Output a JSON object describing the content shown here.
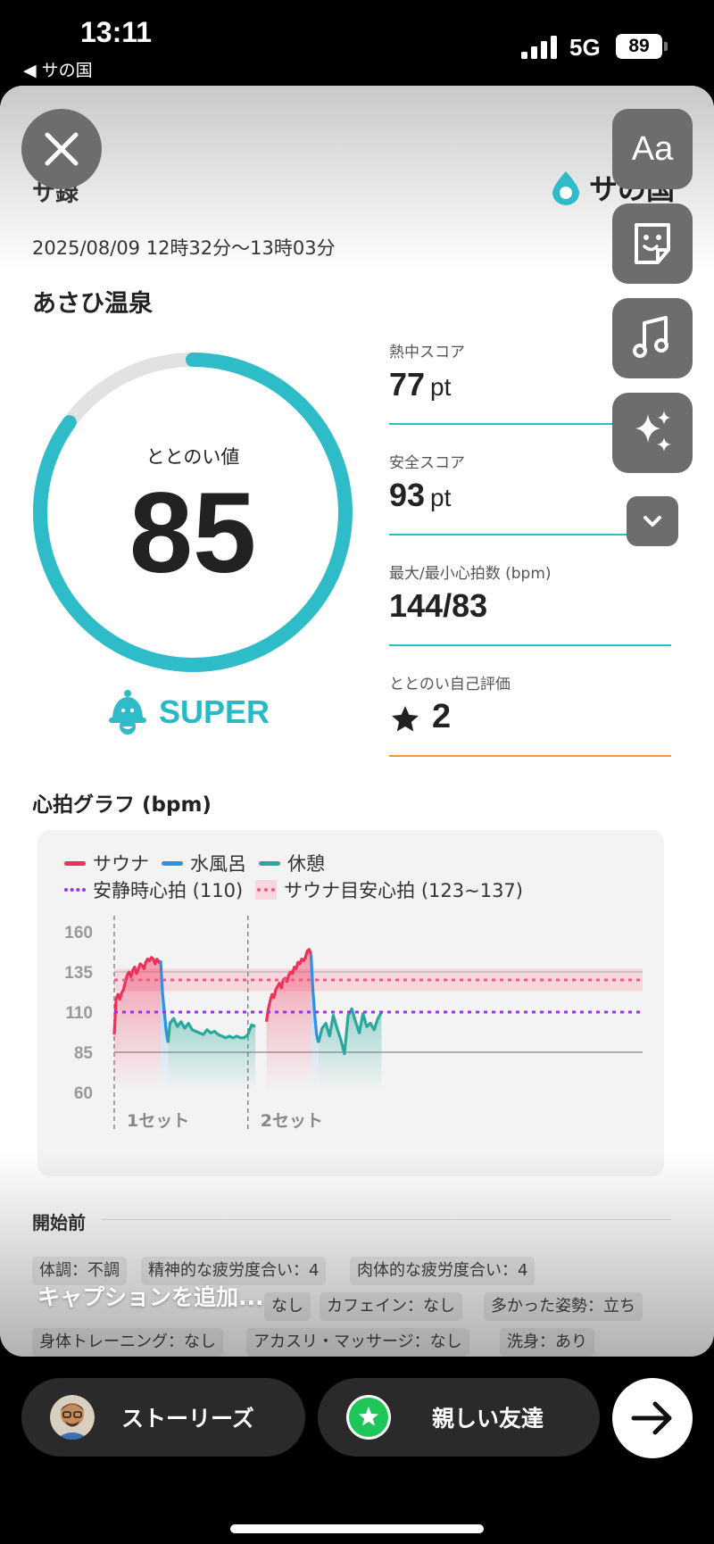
{
  "status_bar": {
    "time": "13:11",
    "back_app": "◀ サの国",
    "network": "5G",
    "battery": "89"
  },
  "card": {
    "title_fragment": "サ録",
    "brand_name": "サの国",
    "date_range": "2025/08/09 12時32分〜13時03分",
    "place": "あさひ温泉",
    "gauge": {
      "label": "ととのい値",
      "value": "85",
      "value_max": 100,
      "grade": "SUPER",
      "accent_color": "#2fbcc9"
    },
    "stats": [
      {
        "label": "熱中スコア",
        "value": "77",
        "unit": "pt"
      },
      {
        "label": "安全スコア",
        "value": "93",
        "unit": "pt"
      },
      {
        "label": "最大/最小心拍数 (bpm)",
        "value": "144/83",
        "unit": ""
      },
      {
        "label": "ととのい自己評価",
        "value": "2",
        "unit": ""
      }
    ],
    "heart_chart": {
      "title": "心拍グラフ (bpm)",
      "legend": {
        "sauna": "サウナ",
        "cold_bath": "水風呂",
        "rest": "休憩",
        "resting_hr": "安静時心拍 (110)",
        "sauna_target": "サウナ目安心拍 (123~137)"
      },
      "set_labels": [
        "1セット",
        "2セット"
      ]
    },
    "before": {
      "title": "開始前",
      "chips": [
        "体調：不調",
        "精神的な疲労度合い：4",
        "肉体的な疲労度合い：4",
        "なし",
        "カフェイン：なし",
        "多かった姿勢：立ち",
        "身体トレーニング：なし",
        "アカスリ・マッサージ：なし",
        "洗身：あり"
      ]
    },
    "caption_placeholder": "キャプションを追加..."
  },
  "toolbar": {
    "text_tool": "Aa"
  },
  "share_bar": {
    "stories": "ストーリーズ",
    "close_friends": "親しい友達"
  },
  "colors": {
    "sauna": "#f0305a",
    "cold_bath": "#2d8fe6",
    "rest": "#2aa89b",
    "resting_hr": "#9b30e6",
    "sauna_target": "#ef5a8a",
    "teal": "#2fbcc9",
    "orange": "#f2973a"
  },
  "chart_data": {
    "type": "line",
    "title": "心拍グラフ (bpm)",
    "xlabel": "",
    "ylabel": "",
    "ylim": [
      60,
      160
    ],
    "yticks": [
      160,
      135,
      110,
      85,
      60
    ],
    "x_categories": [
      "1セット",
      "2セット"
    ],
    "reference_lines": [
      {
        "name": "安静時心拍 (110)",
        "value": 110
      },
      {
        "name": "サウナ目安心拍 (123~137)",
        "band": [
          123,
          137
        ],
        "line": 130
      }
    ],
    "series": [
      {
        "name": "サウナ",
        "segments": [
          {
            "x": [
              0,
              1,
              2,
              3,
              4,
              5,
              6,
              7,
              8,
              9,
              10,
              11,
              12,
              13,
              14,
              15,
              16,
              17,
              18,
              19,
              20,
              21,
              22,
              23,
              24,
              25
            ],
            "y": [
              96,
              118,
              121,
              118,
              122,
              124,
              129,
              133,
              135,
              132,
              136,
              138,
              134,
              137,
              140,
              139,
              137,
              141,
              143,
              142,
              144,
              143,
              140,
              143,
              141,
              142
            ]
          },
          {
            "x": [
              82,
              83,
              84,
              85,
              86,
              87,
              88,
              89,
              90,
              91,
              92,
              93,
              94,
              95,
              96,
              97,
              98,
              99,
              100,
              101,
              102,
              103,
              104,
              105,
              106
            ],
            "y": [
              104,
              112,
              117,
              121,
              119,
              124,
              126,
              128,
              125,
              130,
              131,
              129,
              133,
              135,
              134,
              138,
              137,
              141,
              140,
              143,
              142,
              144,
              148,
              149,
              146
            ]
          }
        ]
      },
      {
        "name": "水風呂",
        "segments": [
          {
            "x": [
              25,
              26,
              27,
              28,
              29
            ],
            "y": [
              142,
              122,
              110,
              98,
              91
            ]
          },
          {
            "x": [
              106,
              107,
              108,
              109,
              110
            ],
            "y": [
              146,
              124,
              108,
              96,
              91
            ]
          }
        ]
      },
      {
        "name": "休憩",
        "segments": [
          {
            "x": [
              29,
              30,
              32,
              34,
              36,
              38,
              40,
              42,
              44,
              46,
              48,
              50,
              52,
              54,
              56,
              58,
              60,
              62,
              64,
              66,
              68,
              70,
              72,
              74,
              76
            ],
            "y": [
              91,
              103,
              106,
              101,
              104,
              100,
              103,
              99,
              98,
              97,
              96,
              99,
              97,
              98,
              96,
              95,
              94,
              95,
              94,
              95,
              94,
              94,
              96,
              102,
              101
            ]
          },
          {
            "x": [
              110,
              112,
              114,
              116,
              118,
              120,
              122,
              124,
              126,
              128,
              130,
              132,
              134,
              136,
              138,
              140,
              142,
              144
            ],
            "y": [
              91,
              100,
              103,
              95,
              108,
              100,
              93,
              84,
              108,
              112,
              104,
              97,
              109,
              101,
              103,
              99,
              106,
              110
            ]
          }
        ]
      }
    ]
  }
}
